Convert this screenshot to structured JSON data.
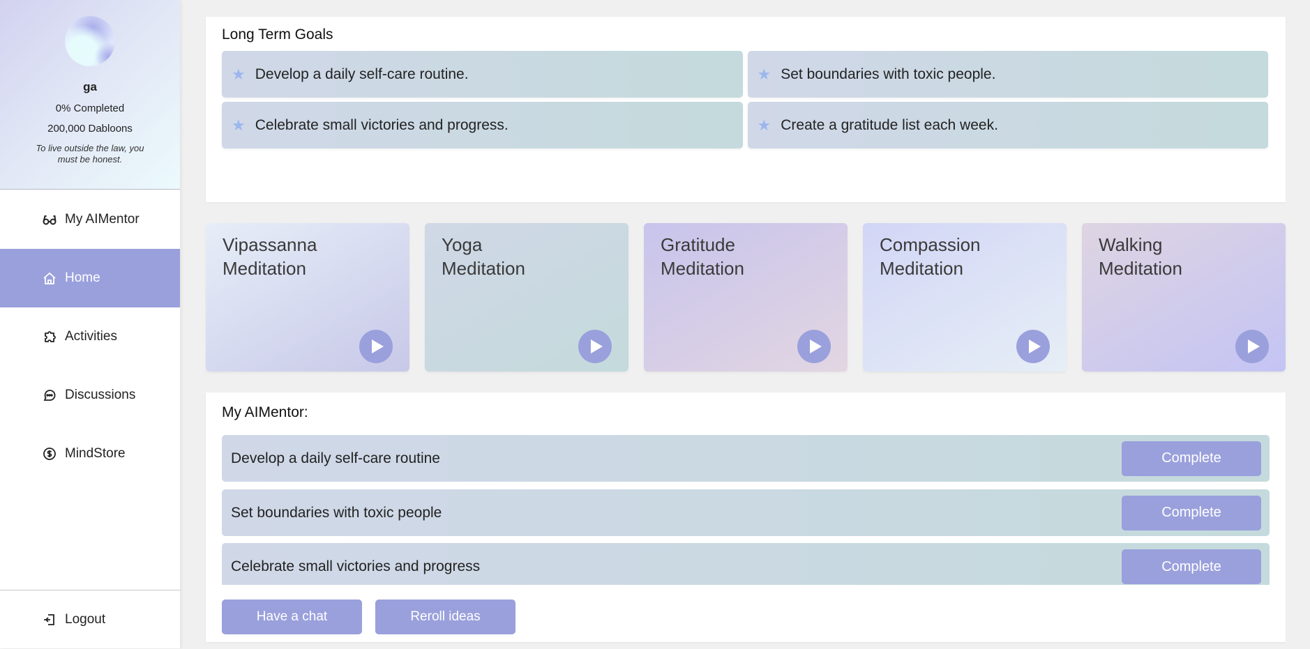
{
  "profile": {
    "name": "ga",
    "completion": "0% Completed",
    "currency": "200,000 Dabloons",
    "quote": "To live outside the law, you must be honest."
  },
  "nav": {
    "items": [
      {
        "label": "My AIMentor",
        "icon": "glasses-icon"
      },
      {
        "label": "Home",
        "icon": "home-icon",
        "active": true
      },
      {
        "label": "Activities",
        "icon": "puzzle-icon"
      },
      {
        "label": "Discussions",
        "icon": "chat-icon"
      },
      {
        "label": "MindStore",
        "icon": "dollar-icon"
      }
    ],
    "logout": "Logout"
  },
  "goals": {
    "title": "Long Term Goals",
    "items": [
      "Develop a daily self-care routine.",
      "Set boundaries with toxic people.",
      "Celebrate small victories and progress.",
      "Create a gratitude list each week."
    ]
  },
  "meditations": [
    {
      "line1": "Vipassanna",
      "line2": "Meditation"
    },
    {
      "line1": "Yoga",
      "line2": "Meditation"
    },
    {
      "line1": "Gratitude",
      "line2": "Meditation"
    },
    {
      "line1": "Compassion",
      "line2": "Meditation"
    },
    {
      "line1": "Walking",
      "line2": "Meditation"
    }
  ],
  "mentor": {
    "title": "My AIMentor:",
    "tasks": [
      "Develop a daily self-care routine",
      "Set boundaries with toxic people",
      "Celebrate small victories and progress"
    ],
    "complete_label": "Complete",
    "chat_label": "Have a chat",
    "reroll_label": "Reroll ideas"
  },
  "colors": {
    "accent": "#9aa0dc",
    "star": "#9cb6ee",
    "background": "#f0f0f0"
  }
}
